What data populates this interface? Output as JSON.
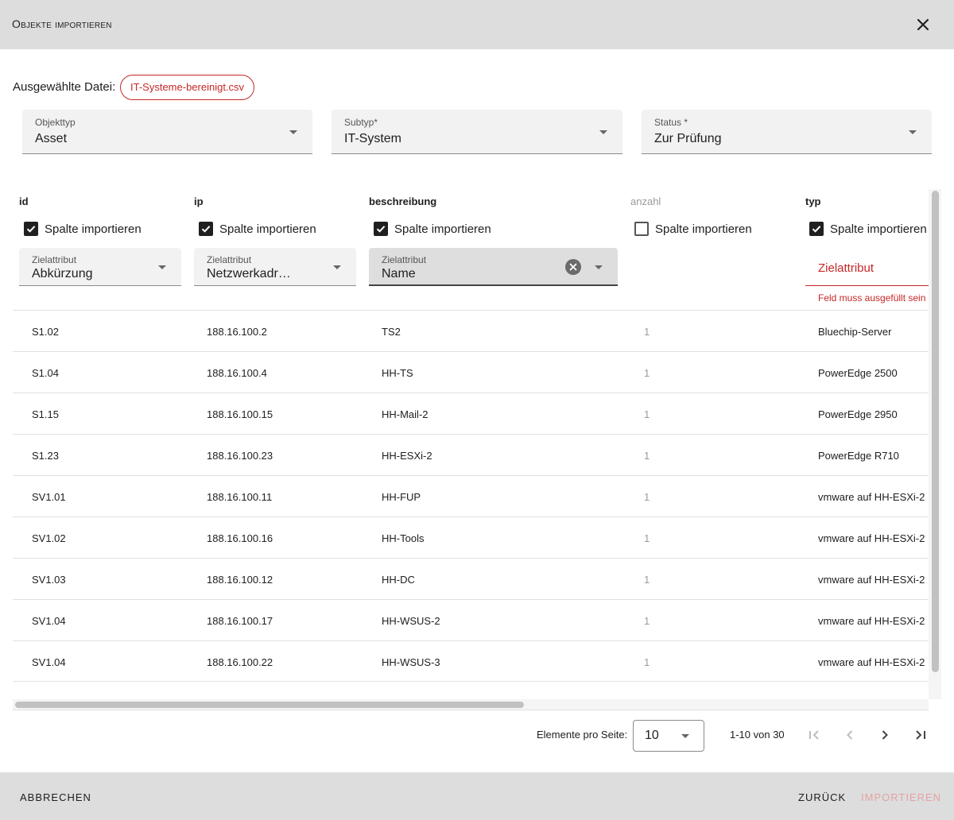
{
  "dialog": {
    "title": "Objekte importieren",
    "close_icon": "close-icon"
  },
  "file": {
    "label": "Ausgewählte Datei:",
    "name": "IT-Systeme-bereinigt.csv"
  },
  "selects": {
    "objekttyp": {
      "label": "Objekttyp",
      "value": "Asset"
    },
    "subtyp": {
      "label": "Subtyp*",
      "value": "IT-System"
    },
    "status": {
      "label": "Status *",
      "value": "Zur Prüfung"
    }
  },
  "columns": [
    {
      "header": "id",
      "checkbox_label": "Spalte importieren",
      "checked": true,
      "target_label": "Zielattribut",
      "target_value": "Abkürzung"
    },
    {
      "header": "ip",
      "checkbox_label": "Spalte importieren",
      "checked": true,
      "target_label": "Zielattribut",
      "target_value": "Netzwerkadr…"
    },
    {
      "header": "beschreibung",
      "checkbox_label": "Spalte importieren",
      "checked": true,
      "target_label": "Zielattribut",
      "target_value": "Name"
    },
    {
      "header": "anzahl",
      "checkbox_label": "Spalte importieren",
      "checked": false
    },
    {
      "header": "typ",
      "checkbox_label": "Spalte importieren",
      "checked": true,
      "target_placeholder": "Zielattribut",
      "error": "Feld muss ausgefüllt sein"
    }
  ],
  "rows": [
    [
      "S1.02",
      "188.16.100.2",
      "TS2",
      "1",
      "Bluechip-Server"
    ],
    [
      "S1.04",
      "188.16.100.4",
      "HH-TS",
      "1",
      "PowerEdge 2500"
    ],
    [
      "S1.15",
      "188.16.100.15",
      "HH-Mail-2",
      "1",
      "PowerEdge 2950"
    ],
    [
      "S1.23",
      "188.16.100.23",
      "HH-ESXi-2",
      "1",
      "PowerEdge R710"
    ],
    [
      "SV1.01",
      "188.16.100.11",
      "HH-FUP",
      "1",
      "vmware auf HH-ESXi-2"
    ],
    [
      "SV1.02",
      "188.16.100.16",
      "HH-Tools",
      "1",
      "vmware auf HH-ESXi-2"
    ],
    [
      "SV1.03",
      "188.16.100.12",
      "HH-DC",
      "1",
      "vmware auf HH-ESXi-2"
    ],
    [
      "SV1.04",
      "188.16.100.17",
      "HH-WSUS-2",
      "1",
      "vmware auf HH-ESXi-2"
    ],
    [
      "SV1.04",
      "188.16.100.22",
      "HH-WSUS-3",
      "1",
      "vmware auf HH-ESXi-2"
    ]
  ],
  "paginator": {
    "label": "Elemente pro Seite:",
    "page_size": "10",
    "range": "1-10 von 30"
  },
  "footer": {
    "cancel": "ABBRECHEN",
    "back": "ZURÜCK",
    "import": "IMPORTIEREN"
  },
  "colors": {
    "accent": "#c62828",
    "header_bg": "#dddddd",
    "field_bg": "#f2f2f2",
    "disabled_text": "#e3a3a3"
  }
}
